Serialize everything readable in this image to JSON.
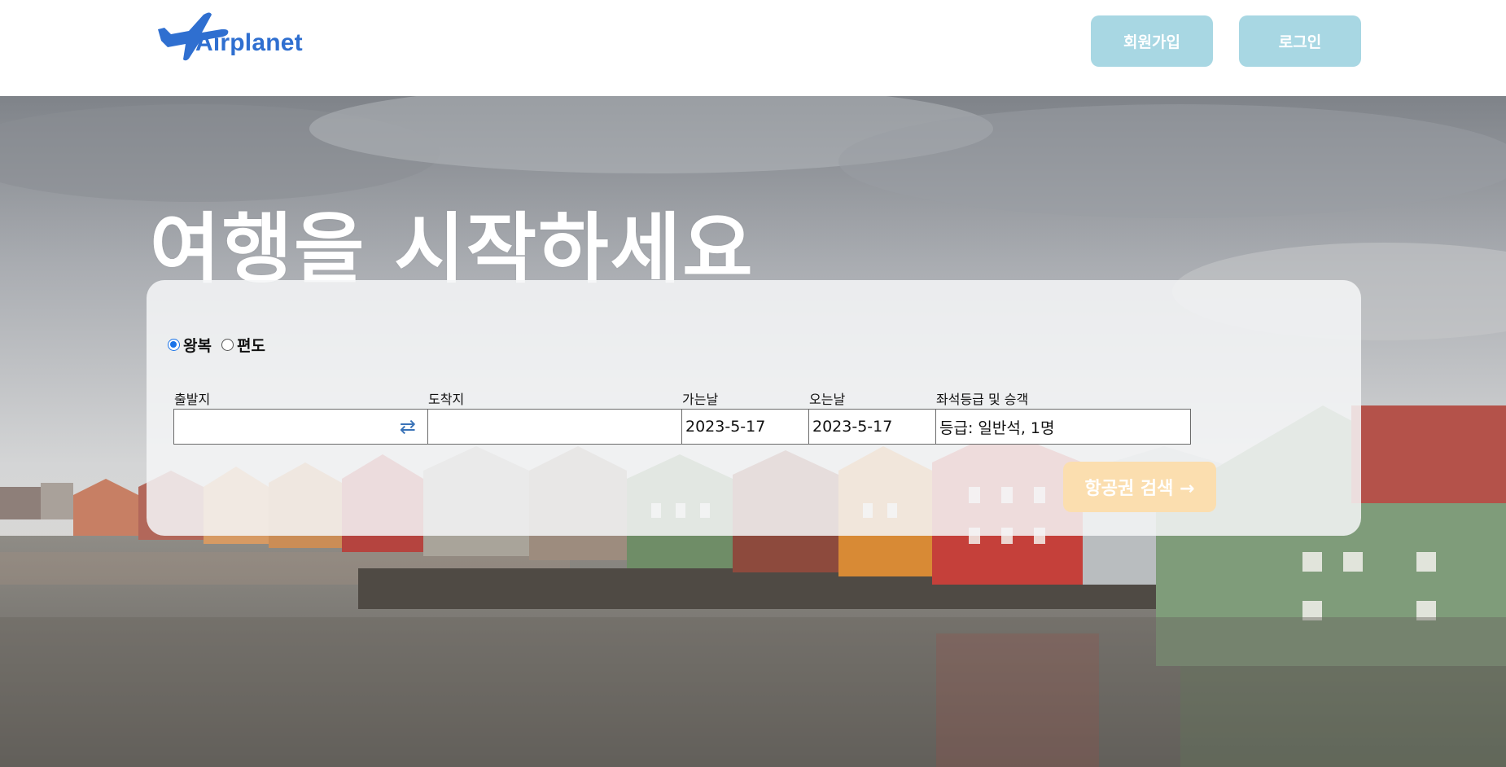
{
  "brand": {
    "name": "Airplanet",
    "logo_icon": "airplane-icon",
    "color": "#2f6fd0"
  },
  "header": {
    "signup_label": "회원가입",
    "login_label": "로그인",
    "button_color": "#a8d7e3"
  },
  "hero": {
    "title": "여행을 시작하세요"
  },
  "search": {
    "trip_types": [
      {
        "label": "왕복",
        "selected": true
      },
      {
        "label": "편도",
        "selected": false
      }
    ],
    "fields": {
      "origin": {
        "label": "출발지",
        "value": ""
      },
      "destination": {
        "label": "도착지",
        "value": ""
      },
      "depart_date": {
        "label": "가는날",
        "value": "2023-5-17"
      },
      "return_date": {
        "label": "오는날",
        "value": "2023-5-17"
      },
      "seat_passengers": {
        "label": "좌석등급 및 승객",
        "value": "등급: 일반석, 1명"
      }
    },
    "swap_icon": "⇄",
    "search_button_label": "항공권 검색 →",
    "search_button_color": "#fbdeaf"
  }
}
